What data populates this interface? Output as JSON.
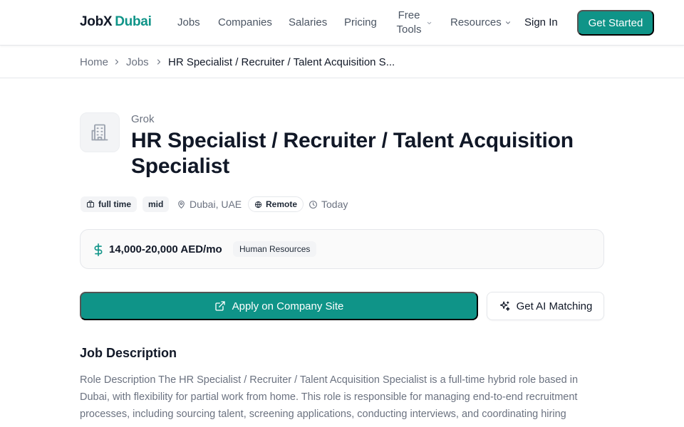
{
  "brand": {
    "part1": "JobX",
    "part2": "Dubai"
  },
  "nav": {
    "jobs": "Jobs",
    "companies": "Companies",
    "salaries": "Salaries",
    "pricing": "Pricing",
    "free_tools_line1": "Free",
    "free_tools_line2": "Tools",
    "resources": "Resources",
    "sign_in": "Sign In",
    "get_started": "Get Started"
  },
  "breadcrumb": {
    "home": "Home",
    "jobs": "Jobs",
    "current": "HR Specialist / Recruiter / Talent Acquisition S..."
  },
  "job": {
    "company": "Grok",
    "title": "HR Specialist / Recruiter / Talent Acquisition Specialist",
    "employment_type": "full time",
    "level": "mid",
    "location": "Dubai, UAE",
    "work_mode": "Remote",
    "posted": "Today",
    "salary": "14,000-20,000 AED/mo",
    "category": "Human Resources"
  },
  "actions": {
    "apply": "Apply on Company Site",
    "ai_matching": "Get AI Matching"
  },
  "description": {
    "heading": "Job Description",
    "body": "Role Description The HR Specialist / Recruiter / Talent Acquisition Specialist is a full-time hybrid role based in Dubai, with flexibility for partial work from home. This role is responsible for managing end-to-end recruitment processes, including sourcing talent, screening applications, conducting interviews, and coordinating hiring"
  },
  "colors": {
    "accent": "#0f9488",
    "text": "#111827",
    "muted": "#6b7280",
    "border": "#e5e7eb"
  },
  "icons": {
    "company_logo": "building-icon",
    "employment_type": "briefcase-icon",
    "location": "map-pin-icon",
    "work_mode": "globe-icon",
    "posted": "clock-icon",
    "salary": "dollar-icon",
    "apply": "external-link-icon",
    "ai_matching": "sparkles-icon",
    "dropdown": "chevron-down-icon",
    "breadcrumb_separator": "chevron-right-icon"
  }
}
